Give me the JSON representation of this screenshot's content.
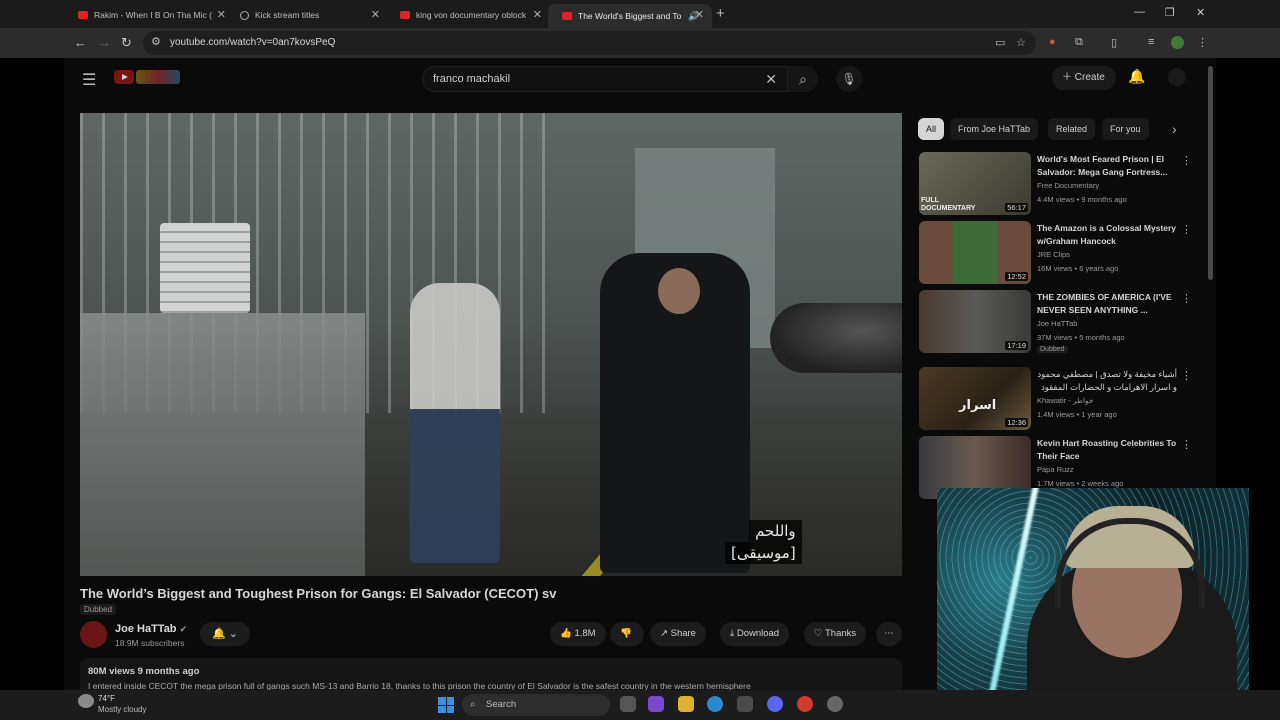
{
  "browser": {
    "tabs": [
      {
        "title": "Rakim - When I B On Tha Mic (",
        "icon": "youtube-icon"
      },
      {
        "title": "Kick stream titles",
        "icon": "globe-icon"
      },
      {
        "title": "king von documentary oblock",
        "icon": "youtube-icon"
      },
      {
        "title": "The World's Biggest and To",
        "icon": "youtube-icon",
        "active": true,
        "audio": true
      }
    ],
    "url": "youtube.com/watch?v=0an7kovsPeQ"
  },
  "youtube": {
    "search_query": "franco machakil",
    "create_label": "Create",
    "video": {
      "subtitle_line1": "واللحم",
      "subtitle_line2": "[موسيقى]",
      "title": "The World’s Biggest and Toughest Prison for Gangs: El Salvador (CECOT) sv",
      "dubbed": "Dubbed",
      "channel": "Joe HaTTab",
      "subscribers": "18.9M subscribers",
      "likes": "1.8M",
      "share_label": "Share",
      "download_label": "Download",
      "thanks_label": "Thanks",
      "views_date": "80M views  9 months ago",
      "description": "I entered inside CECOT the mega prison full of gangs such MS-13 and Barrio 18, thanks to this prison the country of El Salvador is the safest country in the western hemisphere"
    },
    "chips": [
      "All",
      "From Joe HaTTab",
      "Related",
      "For you"
    ],
    "recommendations": [
      {
        "title": "World's Most Feared Prison | El Salvador: Mega Gang Fortress...",
        "channel": "Free Documentary",
        "meta": "4.4M views • 9 months ago",
        "duration": "56:17",
        "thumb_text": "FULL DOCUMENTARY"
      },
      {
        "title": "The Amazon is a Colossal Mystery w/Graham Hancock",
        "channel": "JRE Clips",
        "meta": "16M views • 6 years ago",
        "duration": "12:52"
      },
      {
        "title": "THE ZOMBIES OF AMERICA (I'VE NEVER SEEN ANYTHING ...",
        "channel": "Joe HaTTab",
        "meta": "37M views • 5 months ago",
        "duration": "17:19",
        "badge": "Dubbed"
      },
      {
        "title": "أشياء مخيفة ولا تصدق | مصطفي محمود و اسرار الاهرامات و الحضارات المفقود",
        "channel": "Khawatir - خواطر",
        "meta": "1.4M views • 1 year ago",
        "duration": "12:36",
        "thumb_text": "اسرار"
      },
      {
        "title": "Kevin Hart Roasting Celebrities To Their Face",
        "channel": "Papa Ruzz",
        "meta": "1.7M views • 2 weeks ago",
        "duration": ""
      }
    ]
  },
  "taskbar": {
    "temp": "74°F",
    "weather": "Mostly cloudy",
    "search_label": "Search"
  },
  "colors": {
    "youtube_red": "#e02424",
    "chip_active": "#d5d5d5",
    "windows_blue": "#3d8fe0"
  }
}
